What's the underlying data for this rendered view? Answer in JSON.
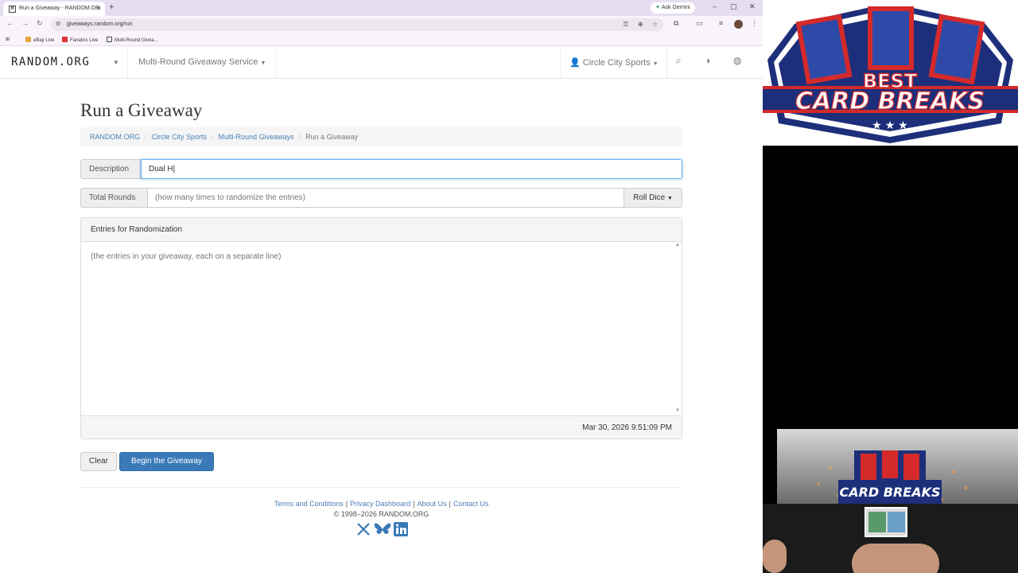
{
  "browser": {
    "tab_title": "Run a Giveaway - RANDOM.OR",
    "tab_favicon": "R",
    "gemini_label": "Ask Gemini",
    "url": "giveaways.random.org/run",
    "bookmarks": [
      "eBay Live",
      "Fanatics Live",
      "Multi-Round Givea..."
    ]
  },
  "site_nav": {
    "brand": "RANDOM.ORG",
    "service": "Multi-Round Giveaway Service",
    "user": "Circle City Sports"
  },
  "page": {
    "title": "Run a Giveaway",
    "breadcrumb": [
      "RANDOM.ORG",
      "Circle City Sports",
      "Multi-Round Giveaways",
      "Run a Giveaway"
    ]
  },
  "form": {
    "description_label": "Description",
    "description_value": "Dual H",
    "rounds_label": "Total Rounds",
    "rounds_placeholder": "(how many times to randomize the entries)",
    "roll_dice": "Roll Dice",
    "entries_header": "Entries for Randomization",
    "entries_placeholder": "(the entries in your giveaway, each on a separate line)",
    "timestamp": "Mar 30, 2026 9:51:09 PM",
    "clear_label": "Clear",
    "begin_label": "Begin the Giveaway"
  },
  "footer": {
    "links": [
      "Terms and Conditions",
      "Privacy Dashboard",
      "About Us",
      "Contact Us"
    ],
    "copyright": "© 1998–2026 RANDOM.ORG",
    "social": [
      "x-icon",
      "bluesky-icon",
      "linkedin-icon"
    ]
  },
  "overlay": {
    "logo_line1": "BEST",
    "logo_line2": "CARD BREAKS",
    "colors": {
      "red": "#d42a2a",
      "navy": "#1d2f7a",
      "blue_link": "#4a7fb5",
      "primary_btn": "#3a7ab8"
    }
  }
}
